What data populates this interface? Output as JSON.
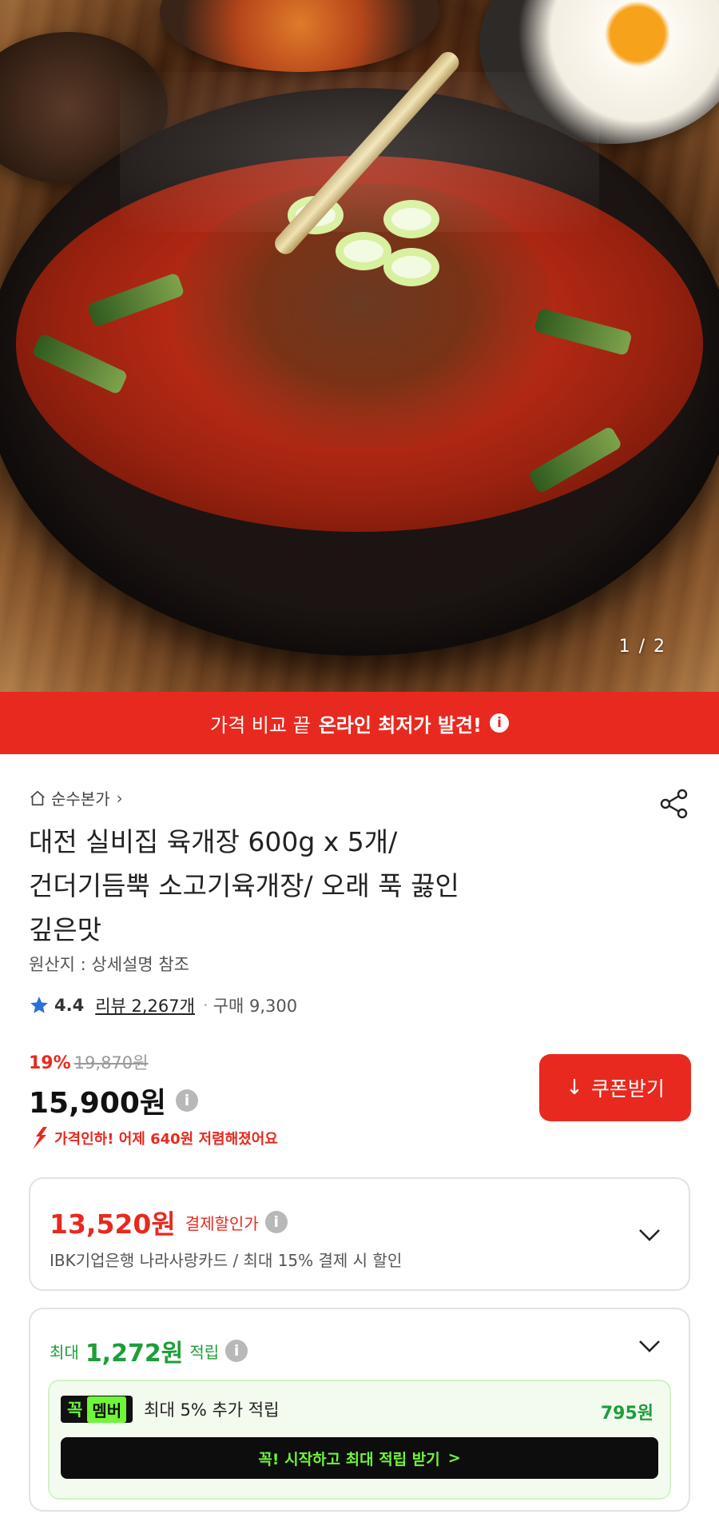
{
  "hero": {
    "page_indicator": "1 / 2"
  },
  "promo_banner": {
    "text_plain": "가격 비교 끝",
    "text_bold": "온라인 최저가 발견!",
    "info_icon": "info-icon"
  },
  "product": {
    "brand": "순수본가",
    "title_lines": [
      "대전 실비집 육개장 600g x 5개/",
      "건더기듬뿍 소고기육개장/ 오래 푹 끓인",
      "깊은맛"
    ],
    "origin": "원산지 : 상세설명 참조",
    "rating": "4.4",
    "review_label": "리뷰 2,267개",
    "purchase_label": "구매 9,300",
    "discount_pct": "19%",
    "original_price": "19,870원",
    "price": "15,900원",
    "price_drop_note": "가격인하! 어제 640원 저렴해졌어요"
  },
  "coupon_button": {
    "label": "쿠폰받기"
  },
  "card_discount": {
    "price": "13,520원",
    "label": "결제할인가",
    "subtext": "IBK기업은행 나라사랑카드 / 최대 15% 결제 시 할인"
  },
  "points": {
    "prefix": "최대",
    "value": "1,272원",
    "suffix": "적립",
    "member": {
      "badge_part1": "꼭",
      "badge_part2": "멤버",
      "text": "최대 5% 추가 적립",
      "points": "795원",
      "cta": "꼭! 시작하고 최대 적립 받기",
      "cta_chevron": ">"
    }
  },
  "colors": {
    "accent_red": "#e8291f",
    "accent_green": "#1d9e3a",
    "member_lime": "#6ff53a"
  }
}
